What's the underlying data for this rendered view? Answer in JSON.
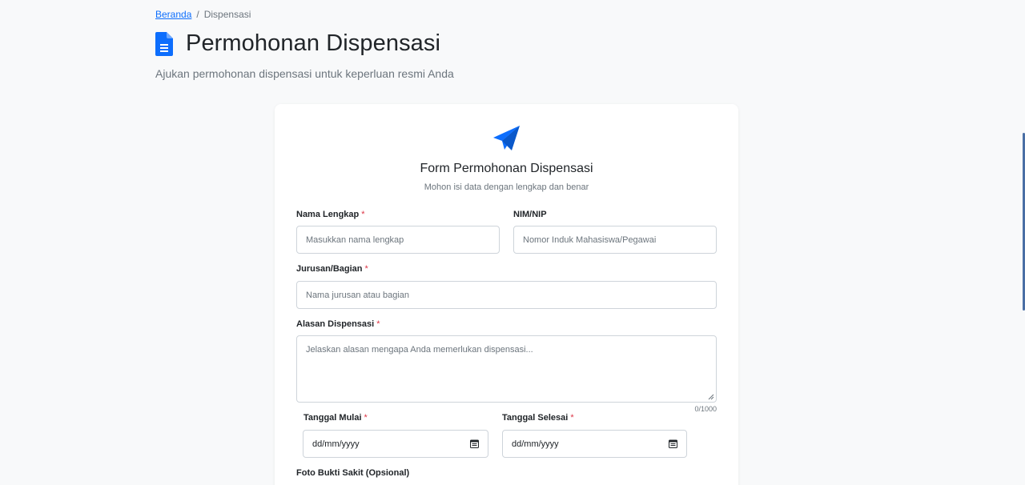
{
  "breadcrumb": {
    "home": "Beranda",
    "separator": "/",
    "current": "Dispensasi"
  },
  "header": {
    "icon": "document-icon",
    "title": "Permohonan Dispensasi",
    "subtitle": "Ajukan permohonan dispensasi untuk keperluan resmi Anda"
  },
  "form": {
    "icon": "paper-plane-icon",
    "title": "Form Permohonan Dispensasi",
    "subtitle": "Mohon isi data dengan lengkap dan benar",
    "required_mark": "*",
    "nama": {
      "label": "Nama Lengkap",
      "placeholder": "Masukkan nama lengkap",
      "value": ""
    },
    "nim": {
      "label": "NIM/NIP",
      "placeholder": "Nomor Induk Mahasiswa/Pegawai",
      "value": ""
    },
    "jurusan": {
      "label": "Jurusan/Bagian",
      "placeholder": "Nama jurusan atau bagian",
      "value": ""
    },
    "alasan": {
      "label": "Alasan Dispensasi",
      "placeholder": "Jelaskan alasan mengapa Anda memerlukan dispensasi...",
      "value": "",
      "counter": "0/1000"
    },
    "tanggal_mulai": {
      "label": "Tanggal Mulai",
      "value": "dd/mm/yyyy",
      "icon": "calendar-icon"
    },
    "tanggal_selesai": {
      "label": "Tanggal Selesai",
      "value": "dd/mm/yyyy",
      "icon": "calendar-icon"
    },
    "foto": {
      "label": "Foto Bukti Sakit (Opsional)"
    }
  },
  "colors": {
    "accent": "#0d6efd",
    "required": "#dc3545",
    "background": "#f8f9fa",
    "card": "#ffffff"
  }
}
